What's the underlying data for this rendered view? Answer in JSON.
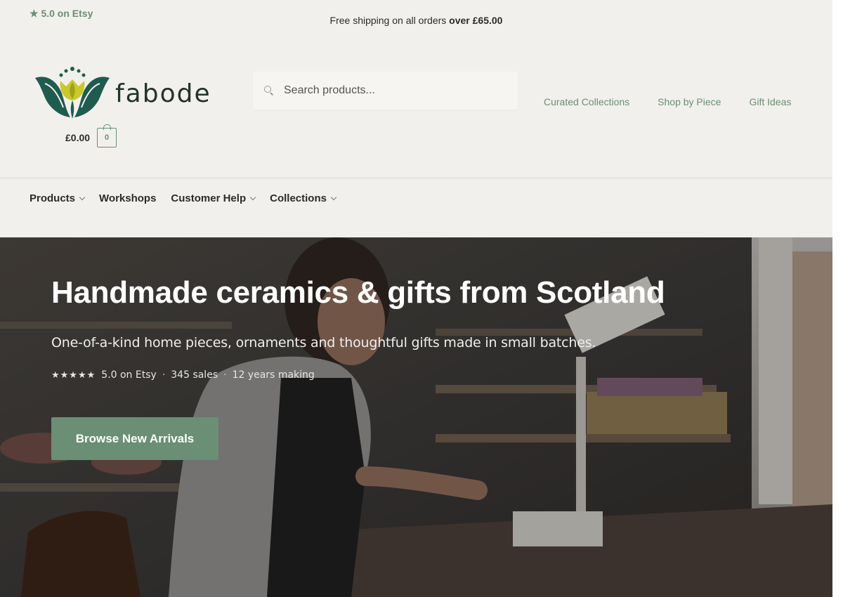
{
  "topbar": {
    "etsy_rating": "★ 5.0 on Etsy",
    "shipping_prefix": "Free shipping on all orders ",
    "shipping_bold": "over £65.00"
  },
  "brand": {
    "name": "fabode",
    "primary_color": "#6a8f74",
    "logo_dark": "#1f5c4f",
    "logo_yellow": "#c9c92a"
  },
  "cart": {
    "total": "£0.00",
    "count": "0"
  },
  "search": {
    "placeholder": "Search products..."
  },
  "secondary_nav": [
    {
      "label": "Curated Collections"
    },
    {
      "label": "Shop by Piece"
    },
    {
      "label": "Gift Ideas"
    }
  ],
  "main_nav": [
    {
      "label": "Products",
      "has_dropdown": true
    },
    {
      "label": "Workshops",
      "has_dropdown": false
    },
    {
      "label": "Customer Help",
      "has_dropdown": true
    },
    {
      "label": "Collections",
      "has_dropdown": true
    }
  ],
  "hero": {
    "title": "Handmade ceramics & gifts from Scotland",
    "subtitle": "One-of-a-kind home pieces, ornaments and thoughtful gifts made in small batches.",
    "stars": "★★★★★",
    "rating": "5.0 on Etsy",
    "sales": "345 sales",
    "years": "12 years making",
    "separator": "·",
    "cta_label": "Browse New Arrivals"
  }
}
